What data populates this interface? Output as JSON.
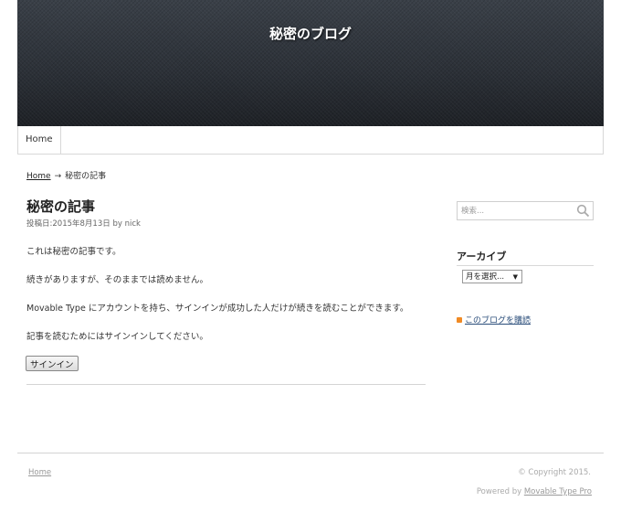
{
  "header": {
    "site_title": "秘密のブログ"
  },
  "nav": {
    "items": [
      {
        "label": "Home"
      }
    ]
  },
  "breadcrumb": {
    "home": "Home",
    "arrow": "→",
    "current": "秘密の記事"
  },
  "entry": {
    "title": "秘密の記事",
    "meta_prefix": "投稿日:",
    "date": "2015年8月13日",
    "by": "by",
    "author": "nick",
    "paragraphs": [
      "これは秘密の記事です。",
      "続きがありますが、そのままでは読めません。",
      "Movable Type にアカウントを持ち、サインインが成功した人だけが続きを読むことができます。",
      "記事を読むためにはサインインしてください。"
    ],
    "signin_label": "サインイン"
  },
  "sidebar": {
    "search_placeholder": "検索...",
    "archive_title": "アーカイブ",
    "archive_select": "月を選択...",
    "subscribe_label": "このブログを購読"
  },
  "footer": {
    "home": "Home",
    "copyright": "© Copyright 2015.",
    "powered_prefix": "Powered by",
    "powered_link": "Movable Type Pro"
  }
}
